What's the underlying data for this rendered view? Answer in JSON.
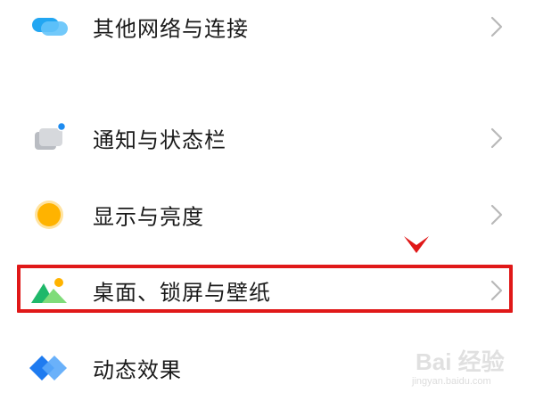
{
  "settings": {
    "items": [
      {
        "label": "其他网络与连接",
        "icon": "network-connection-icon"
      },
      {
        "label": "通知与状态栏",
        "icon": "notification-statusbar-icon"
      },
      {
        "label": "显示与亮度",
        "icon": "display-brightness-icon"
      },
      {
        "label": "桌面、锁屏与壁纸",
        "icon": "wallpaper-icon"
      },
      {
        "label": "动态效果",
        "icon": "motion-effects-icon"
      }
    ],
    "chevron_icon": "chevron-right-icon"
  },
  "annotation": {
    "highlight_color": "#e01818",
    "highlighted_item": "桌面、锁屏与壁纸"
  },
  "watermark": {
    "brand": "Bai 经验",
    "url": "jingyan.baidu.com"
  },
  "colors": {
    "accent_blue": "#1e8cf0",
    "accent_orange": "#ffb300",
    "text": "#1a1a1a",
    "chevron": "#b8b8b8"
  }
}
